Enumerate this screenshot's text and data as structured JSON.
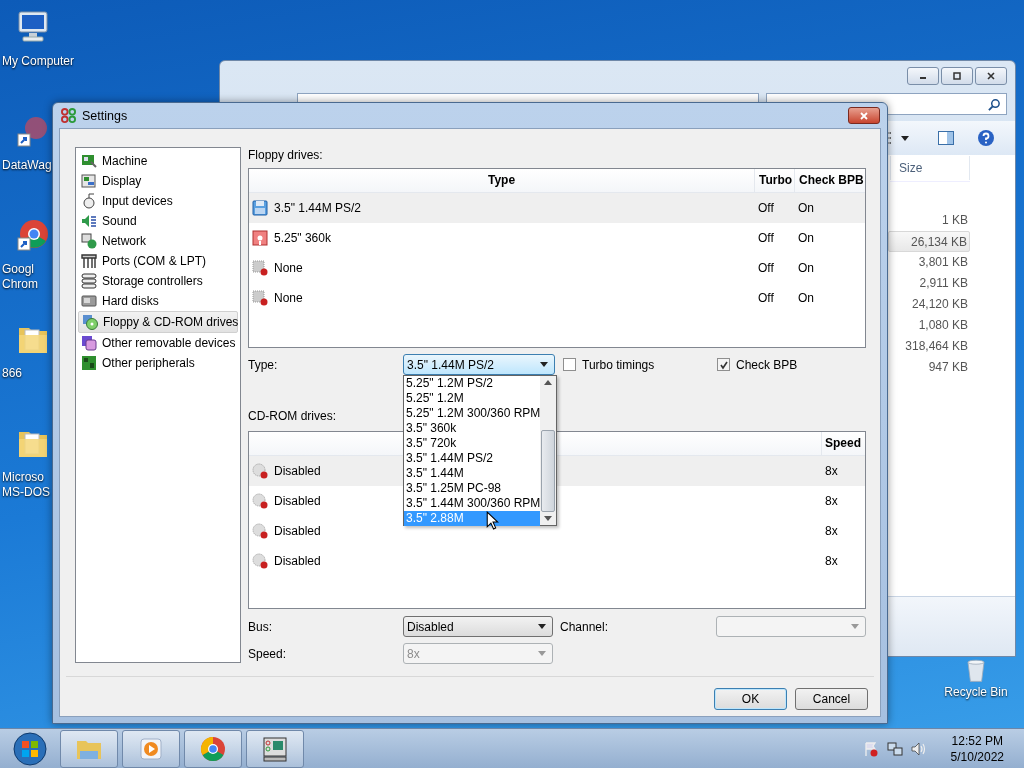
{
  "desktop_icons": [
    {
      "kind": "computer",
      "lines": [
        "My Computer"
      ]
    },
    {
      "kind": "shortcut",
      "lines": [
        "DataWag"
      ]
    },
    {
      "kind": "chrome",
      "lines": [
        "Googl",
        "Chrom"
      ]
    },
    {
      "kind": "folder",
      "lines": [
        "866"
      ]
    },
    {
      "kind": "folder",
      "lines": [
        "Microso",
        "MS-DOS"
      ]
    }
  ],
  "recycle_bin": {
    "label": "Recycle Bin"
  },
  "explorer": {
    "column_header": "Size",
    "rows": [
      {
        "size": "1 KB",
        "selected": false
      },
      {
        "size": "26,134 KB",
        "selected": true
      },
      {
        "size": "3,801 KB",
        "selected": false
      },
      {
        "size": "2,911 KB",
        "selected": false
      },
      {
        "size": "24,120 KB",
        "selected": false
      },
      {
        "size": "1,080 KB",
        "selected": false
      },
      {
        "size": "318,464 KB",
        "selected": false
      },
      {
        "size": "947 KB",
        "selected": false
      }
    ]
  },
  "settings": {
    "title": "Settings",
    "categories": [
      {
        "kind": "machine",
        "label": "Machine",
        "selected": false
      },
      {
        "kind": "display",
        "label": "Display",
        "selected": false
      },
      {
        "kind": "input",
        "label": "Input devices",
        "selected": false
      },
      {
        "kind": "sound",
        "label": "Sound",
        "selected": false
      },
      {
        "kind": "network",
        "label": "Network",
        "selected": false
      },
      {
        "kind": "ports",
        "label": "Ports (COM & LPT)",
        "selected": false
      },
      {
        "kind": "storage",
        "label": "Storage controllers",
        "selected": false
      },
      {
        "kind": "disk",
        "label": "Hard disks",
        "selected": false
      },
      {
        "kind": "drives",
        "label": "Floppy & CD-ROM drives",
        "selected": true
      },
      {
        "kind": "removable",
        "label": "Other removable devices",
        "selected": false
      },
      {
        "kind": "peripherals",
        "label": "Other peripherals",
        "selected": false
      }
    ],
    "floppy": {
      "label": "Floppy drives:",
      "columns": [
        "Type",
        "Turbo",
        "Check BPB"
      ],
      "rows": [
        {
          "kind": "floppy35",
          "type": "3.5\" 1.44M PS/2",
          "turbo": "Off",
          "check_bpb": "On",
          "selected": true
        },
        {
          "kind": "floppy525",
          "type": "5.25\" 360k",
          "turbo": "Off",
          "check_bpb": "On",
          "selected": false
        },
        {
          "kind": "none",
          "type": "None",
          "turbo": "Off",
          "check_bpb": "On",
          "selected": false
        },
        {
          "kind": "none",
          "type": "None",
          "turbo": "Off",
          "check_bpb": "On",
          "selected": false
        }
      ]
    },
    "type_label": "Type:",
    "type_value": "3.5\" 1.44M PS/2",
    "type_options": [
      {
        "label": "5.25\" 1.2M PS/2",
        "selected": false
      },
      {
        "label": "5.25\" 1.2M",
        "selected": false
      },
      {
        "label": "5.25\" 1.2M 300/360 RPM",
        "selected": false
      },
      {
        "label": "3.5\" 360k",
        "selected": false
      },
      {
        "label": "3.5\" 720k",
        "selected": false
      },
      {
        "label": "3.5\" 1.44M PS/2",
        "selected": false
      },
      {
        "label": "3.5\" 1.44M",
        "selected": false
      },
      {
        "label": "3.5\" 1.25M PC-98",
        "selected": false
      },
      {
        "label": "3.5\" 1.44M 300/360 RPM",
        "selected": false
      },
      {
        "label": "3.5\" 2.88M",
        "selected": true
      }
    ],
    "turbo_timings": {
      "label": "Turbo timings",
      "checked": false
    },
    "check_bpb": {
      "label": "Check BPB",
      "checked": true
    },
    "cdrom": {
      "label": "CD-ROM drives:",
      "speed_column": "Speed",
      "rows": [
        {
          "bus": "Disabled",
          "speed": "8x",
          "selected": true
        },
        {
          "bus": "Disabled",
          "speed": "8x",
          "selected": false
        },
        {
          "bus": "Disabled",
          "speed": "8x",
          "selected": false
        },
        {
          "bus": "Disabled",
          "speed": "8x",
          "selected": false
        }
      ]
    },
    "bus": {
      "label": "Bus:",
      "value": "Disabled"
    },
    "channel": {
      "label": "Channel:",
      "disabled": true
    },
    "speed": {
      "label": "Speed:",
      "value": "8x",
      "disabled": true
    },
    "buttons": [
      {
        "label": "OK",
        "default": true
      },
      {
        "label": "Cancel",
        "default": false
      }
    ]
  },
  "taskbar": {
    "apps": [
      {
        "kind": "explorer"
      },
      {
        "kind": "media"
      },
      {
        "kind": "chrome"
      },
      {
        "kind": "emulator"
      }
    ],
    "time": "12:52 PM",
    "date": "5/10/2022"
  }
}
